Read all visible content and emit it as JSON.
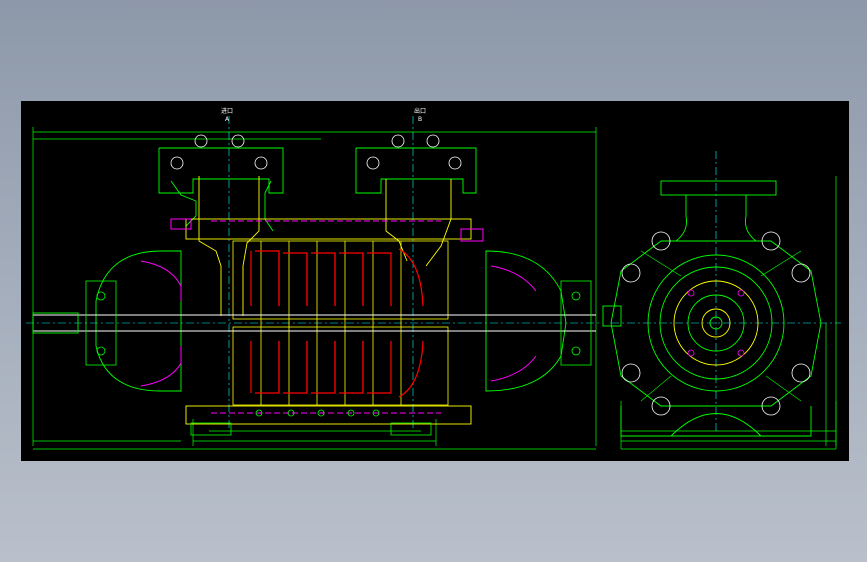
{
  "drawing": {
    "inlet_label": "进口",
    "outlet_label": "出口",
    "inlet_mark": "A",
    "outlet_mark": "B"
  },
  "colors": {
    "background": "#000000",
    "dimension": "#00ff00",
    "section": "#ffff00",
    "impeller": "#ff0000",
    "parts": "#ff00ff",
    "centerline": "#00ffff",
    "text": "#ffffff"
  }
}
